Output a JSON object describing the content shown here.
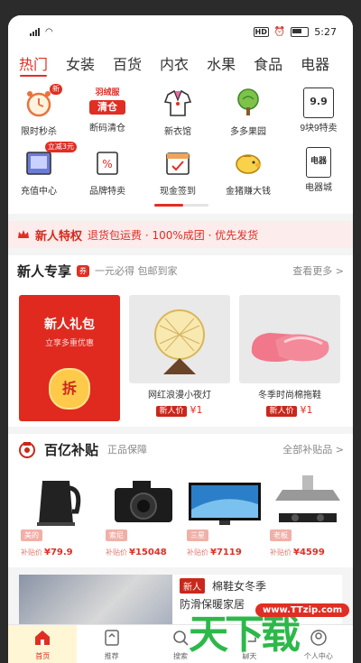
{
  "status": {
    "time": "5:27",
    "hd": "HD"
  },
  "tabs": [
    "热门",
    "女装",
    "百货",
    "内衣",
    "水果",
    "食品",
    "电器"
  ],
  "categories": [
    {
      "label": "限时秒杀",
      "icon": "alarm-clock-icon",
      "badge": "新"
    },
    {
      "label": "断码清仓",
      "icon": "clearance-icon",
      "text": "清仓",
      "top": "羽绒服"
    },
    {
      "label": "新衣馆",
      "icon": "sailor-shirt-icon"
    },
    {
      "label": "多多果园",
      "icon": "tree-icon"
    },
    {
      "label": "9块9特卖",
      "icon": "price-99-icon",
      "text": "9.9"
    },
    {
      "label": "充值中心",
      "icon": "tablet-icon",
      "badge": "立减3元"
    },
    {
      "label": "品牌特卖",
      "icon": "discount-bag-icon"
    },
    {
      "label": "现金签到",
      "icon": "calendar-check-icon"
    },
    {
      "label": "金猪赚大钱",
      "icon": "golden-pig-icon"
    },
    {
      "label": "电器城",
      "icon": "appliance-icon",
      "text": "电器"
    }
  ],
  "new_user": {
    "title": "新人特权",
    "benefits": "退货包运费 · 100%成团 · 优先发货"
  },
  "exclusive": {
    "title": "新人专享",
    "tag": "券",
    "subtitle": "一元必得 包邮到家",
    "more": "查看更多 >",
    "gift": {
      "title": "新人礼包",
      "subtitle": "立享多重优惠",
      "coin": "拆"
    },
    "products": [
      {
        "name": "网红浪漫小夜灯",
        "price_tag": "新人价",
        "price": "¥1"
      },
      {
        "name": "冬季时尚棉拖鞋",
        "price_tag": "新人价",
        "price": "¥1"
      }
    ]
  },
  "subsidy": {
    "title": "百亿补贴",
    "subtitle": "正品保障",
    "more": "全部补贴品 >",
    "items": [
      {
        "brand": "美的",
        "label": "补贴价",
        "price": "¥79.9"
      },
      {
        "brand": "索尼",
        "label": "补贴价",
        "price": "¥15048"
      },
      {
        "brand": "三星",
        "label": "补贴价",
        "price": "¥7119"
      },
      {
        "brand": "老板",
        "label": "补贴价",
        "price": "¥4599"
      }
    ]
  },
  "feed": {
    "badge": "新人",
    "line1": "棉鞋女冬季",
    "line2": "防滑保暖家居"
  },
  "tabbar": [
    {
      "label": "首页",
      "icon": "home-icon"
    },
    {
      "label": "推荐",
      "icon": "recommend-icon"
    },
    {
      "label": "搜索",
      "icon": "search-icon"
    },
    {
      "label": "聊天",
      "icon": "chat-icon"
    },
    {
      "label": "个人中心",
      "icon": "profile-icon"
    }
  ],
  "watermark": {
    "text": "天下载",
    "url": "www.TTzip.com"
  },
  "colors": {
    "accent": "#e02e24",
    "watermark": "#2db84a"
  }
}
